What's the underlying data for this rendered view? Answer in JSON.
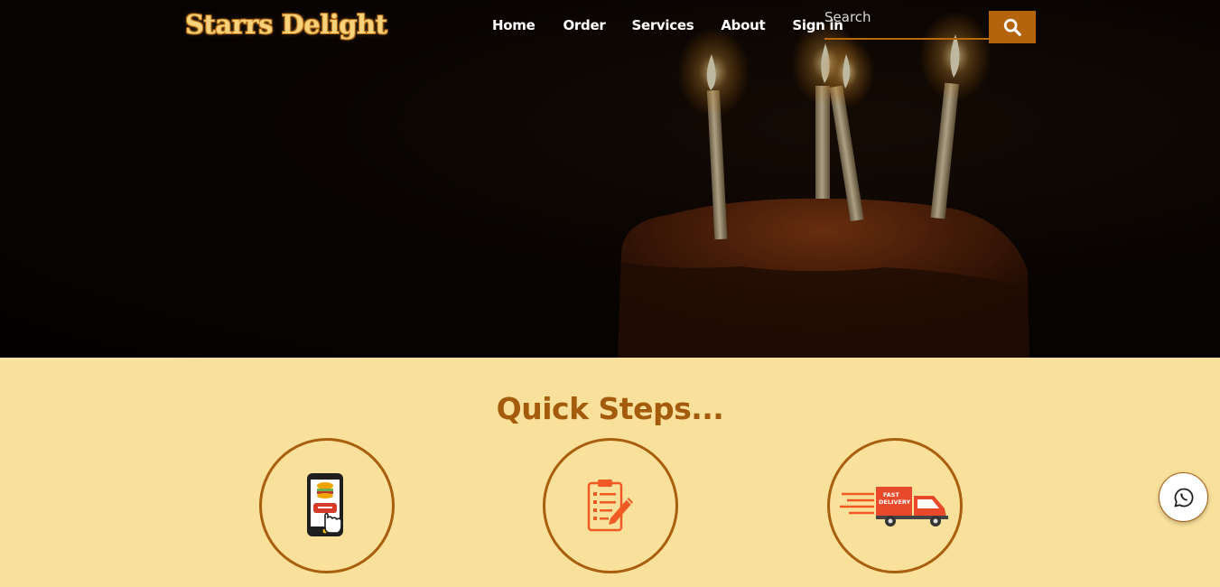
{
  "brand": {
    "logo_text": "Starrs Delight"
  },
  "nav": {
    "items": [
      "Home",
      "Order",
      "Services",
      "About",
      "Sign in"
    ]
  },
  "search": {
    "placeholder": "Search",
    "button_icon": "search-icon"
  },
  "hero": {
    "image": "birthday-cake-with-candles"
  },
  "quick_steps": {
    "title": "Quick Steps...",
    "steps": [
      {
        "icon": "mobile-order-icon"
      },
      {
        "icon": "clipboard-edit-icon"
      },
      {
        "icon": "fast-delivery-truck-icon"
      }
    ]
  },
  "floating": {
    "icon": "whatsapp-icon"
  },
  "colors": {
    "accent": "#b3640c",
    "section_bg": "#f9e09b",
    "title": "#a45c0c"
  }
}
